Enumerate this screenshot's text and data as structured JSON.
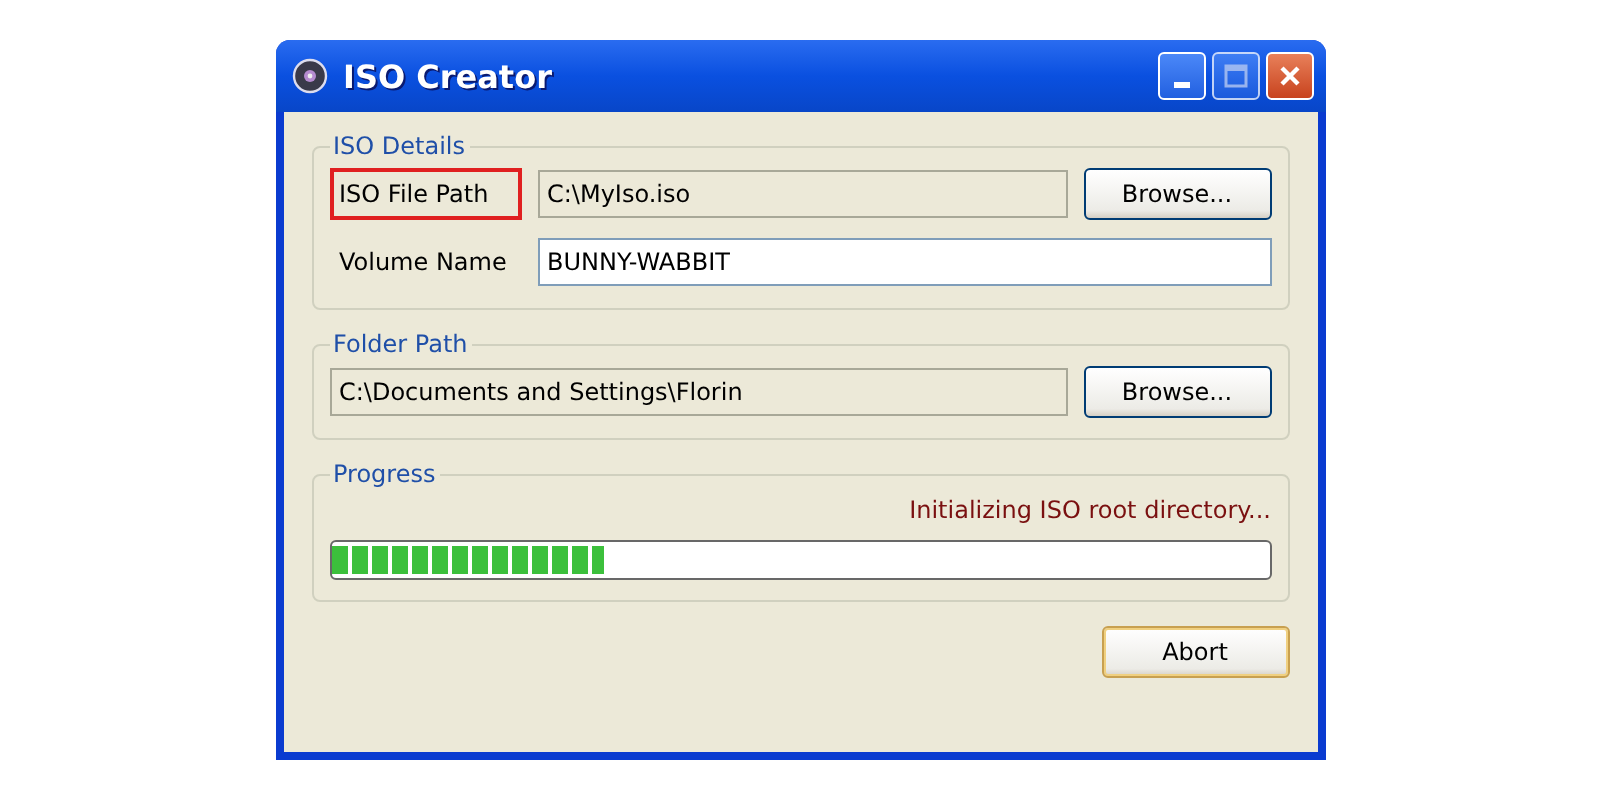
{
  "window": {
    "title": "ISO Creator"
  },
  "iso_details": {
    "title": "ISO Details",
    "rows": [
      {
        "label": "ISO File Path",
        "highlighted": true,
        "value": "C:\\MyIso.iso",
        "readonly": true,
        "button": "Browse..."
      },
      {
        "label": "Volume Name",
        "highlighted": false,
        "value": "BUNNY-WABBIT",
        "readonly": false
      }
    ]
  },
  "folder_path": {
    "title": "Folder Path",
    "value": "C:\\Documents and Settings\\Florin",
    "readonly": true,
    "button": "Browse..."
  },
  "progress": {
    "title": "Progress",
    "status": "Initializing ISO root directory...",
    "level": 0.29
  },
  "buttons": [
    "Abort"
  ]
}
